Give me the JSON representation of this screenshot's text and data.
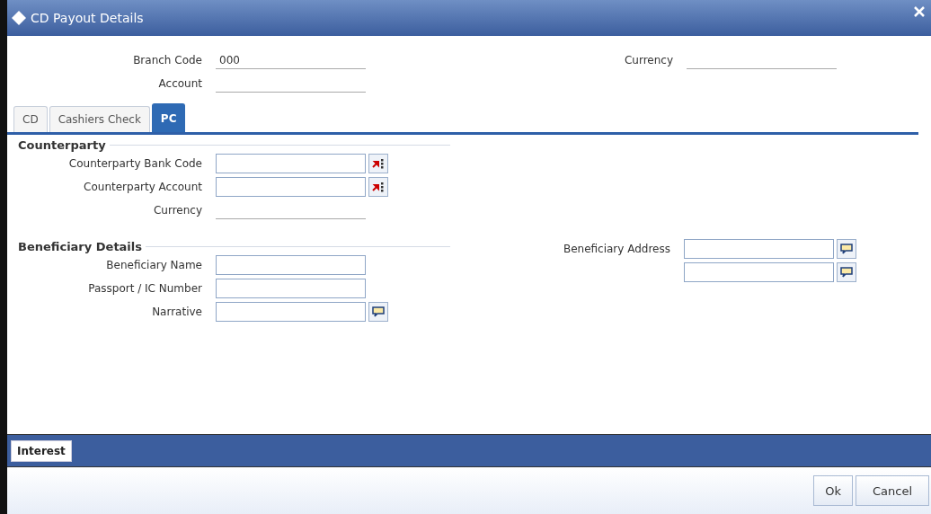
{
  "window": {
    "title": "CD Payout Details"
  },
  "header": {
    "left_fields": [
      {
        "label": "Branch Code",
        "value": "000"
      },
      {
        "label": "Account"
      }
    ],
    "right_fields": [
      {
        "label": "Currency"
      }
    ]
  },
  "tabs": [
    {
      "label": "CD",
      "selected": false
    },
    {
      "label": "Cashiers Check",
      "selected": false
    },
    {
      "label": "PC",
      "selected": true
    }
  ],
  "sections": [
    {
      "title": "Counterparty",
      "left_fields": [
        {
          "label": "Counterparty Bank Code",
          "kind": "lookup"
        },
        {
          "label": "Counterparty Account",
          "kind": "lookup"
        },
        {
          "label": "Currency",
          "kind": "display"
        }
      ]
    },
    {
      "title": "Beneficiary Details",
      "left_fields": [
        {
          "label": "Beneficiary Name",
          "kind": "input"
        },
        {
          "label": "Passport / IC Number",
          "kind": "input"
        },
        {
          "label": "Narrative",
          "kind": "textinput"
        }
      ],
      "right_fields": [
        {
          "label": "Beneficiary Address",
          "kind": "textinput"
        },
        {
          "kind": "textinput"
        }
      ]
    }
  ],
  "bottom_tabs": [
    {
      "label": "Interest"
    }
  ],
  "buttons": [
    "Ok",
    "Cancel"
  ]
}
